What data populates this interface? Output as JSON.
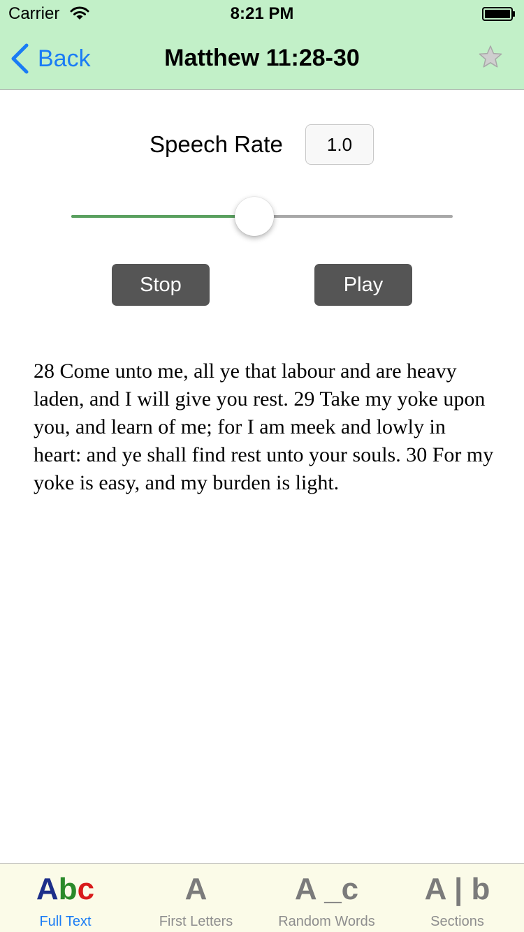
{
  "status_bar": {
    "carrier": "Carrier",
    "time": "8:21 PM"
  },
  "nav": {
    "back_label": "Back",
    "title": "Matthew 11:28-30",
    "favorite_icon": "star-icon"
  },
  "speech": {
    "label": "Speech Rate",
    "rate_value": "1.0",
    "slider_level": 0.48,
    "fill_color": "#5aa05f"
  },
  "controls": {
    "stop_label": "Stop",
    "play_label": "Play"
  },
  "verse": {
    "text": "28 Come unto me, all ye that labour and are heavy laden, and I will give you rest. 29 Take my yoke upon you, and learn of me; for I am meek and lowly in heart: and ye shall find rest unto your souls. 30 For my yoke is easy, and my burden is light."
  },
  "tabs": [
    {
      "icon_parts": [
        "A",
        "b",
        "c"
      ],
      "label": "Full Text",
      "active": true
    },
    {
      "icon_text": "A",
      "label": "First Letters",
      "active": false
    },
    {
      "icon_text": "A _c",
      "label": "Random Words",
      "active": false
    },
    {
      "icon_text": "A | b",
      "label": "Sections",
      "active": false
    }
  ],
  "colors": {
    "bar_green": "#c2f0c8",
    "accent_blue": "#1a7cf5",
    "button_gray": "#555555",
    "tab_bar_bg": "#fbfbe8"
  }
}
